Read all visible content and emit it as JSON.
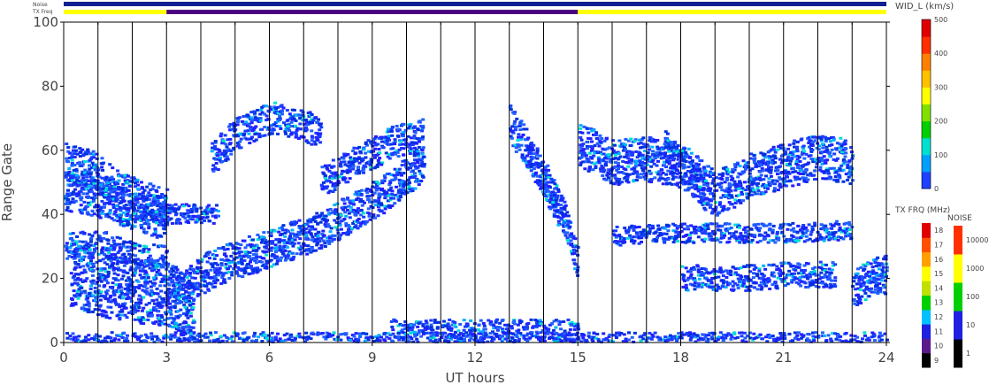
{
  "chart_data": {
    "type": "heatmap",
    "xlabel": "UT hours",
    "ylabel": "Range Gate",
    "xlim": [
      0,
      24
    ],
    "ylim": [
      0,
      100
    ],
    "x_ticks": [
      "0",
      "3",
      "6",
      "9",
      "12",
      "15",
      "18",
      "21",
      "24"
    ],
    "y_ticks": [
      "0",
      "20",
      "40",
      "60",
      "80",
      "100"
    ],
    "top_strips": {
      "noise_label": "Noise",
      "txfreq_label": "TX Freq",
      "txfreq_segments": [
        {
          "from": 0,
          "to": 3,
          "color": "#ffff00"
        },
        {
          "from": 3,
          "to": 15,
          "color": "#4b0082"
        },
        {
          "from": 15,
          "to": 24,
          "color": "#ffff00"
        }
      ]
    },
    "width_scale": {
      "label": "WID_L (km/s)",
      "ticks": [
        "0",
        "100",
        "200",
        "300",
        "400",
        "500"
      ],
      "colors": [
        "#2040ff",
        "#00a0ff",
        "#00e0d0",
        "#00d000",
        "#80e000",
        "#ffff00",
        "#ffc000",
        "#ff8000",
        "#ff3000",
        "#e00000"
      ]
    },
    "txfreq_scale": {
      "label": "TX FRQ (MHz)",
      "ticks": [
        "9",
        "10",
        "11",
        "12",
        "13",
        "14",
        "15",
        "16",
        "17",
        "18"
      ],
      "colors": [
        "#000000",
        "#5a1a8a",
        "#2020e0",
        "#00c0ff",
        "#00d000",
        "#c0e000",
        "#ffff00",
        "#ffa000",
        "#ff5000",
        "#e00000"
      ]
    },
    "noise_scale": {
      "label": "NOISE",
      "ticks": [
        "1",
        "10",
        "100",
        "1000",
        "10000"
      ],
      "colors": [
        "#000000",
        "#2020e0",
        "#00d000",
        "#ffff00",
        "#ff3000"
      ]
    },
    "echo_bands": [
      {
        "t": [
          0,
          1,
          2,
          3
        ],
        "g": [
          47,
          45,
          41,
          37
        ],
        "w": 6
      },
      {
        "t": [
          0,
          0.8,
          1.6,
          2.3,
          3
        ],
        "g": [
          56,
          54,
          47,
          44,
          42
        ],
        "w": 6
      },
      {
        "t": [
          0,
          1,
          2,
          3
        ],
        "g": [
          30,
          31,
          27,
          26
        ],
        "w": 4
      },
      {
        "t": [
          0.2,
          1,
          2,
          3,
          3.8
        ],
        "g": [
          21,
          18,
          16,
          15,
          10
        ],
        "w": 10
      },
      {
        "t": [
          3,
          4.5,
          6,
          7.5,
          9,
          10.5
        ],
        "g": [
          15,
          24,
          29,
          35,
          44,
          56
        ],
        "w": 6
      },
      {
        "t": [
          3,
          4,
          4.5
        ],
        "g": [
          40,
          40,
          40
        ],
        "w": 3
      },
      {
        "t": [
          4.3,
          5,
          6,
          7,
          7.5
        ],
        "g": [
          57,
          65,
          70,
          68,
          64
        ],
        "w": 5
      },
      {
        "t": [
          7.5,
          8.5,
          9.5,
          10.5
        ],
        "g": [
          50,
          56,
          62,
          65
        ],
        "w": 5
      },
      {
        "t": [
          13,
          13.8,
          14.5,
          15
        ],
        "g": [
          68,
          55,
          40,
          25
        ],
        "w": 6
      },
      {
        "t": [
          13.5,
          14,
          14.6
        ],
        "g": [
          58,
          50,
          40
        ],
        "w": 4
      },
      {
        "t": [
          15,
          16,
          17,
          18,
          19,
          20,
          21,
          22,
          23
        ],
        "g": [
          62,
          56,
          57,
          55,
          46,
          52,
          55,
          58,
          56
        ],
        "w": 7
      },
      {
        "t": [
          17.5,
          18.3,
          18.7
        ],
        "g": [
          62,
          52,
          45
        ],
        "w": 5
      },
      {
        "t": [
          16,
          18,
          20,
          21,
          23
        ],
        "g": [
          33,
          34,
          34,
          34,
          35
        ],
        "w": 3
      },
      {
        "t": [
          18,
          19,
          20,
          21,
          22.5
        ],
        "g": [
          20,
          20,
          20,
          21,
          21
        ],
        "w": 4
      },
      {
        "t": [
          23,
          23.5,
          24
        ],
        "g": [
          16,
          20,
          21
        ],
        "w": 6
      },
      {
        "t": [
          9.5,
          12,
          15
        ],
        "g": [
          3,
          3,
          3
        ],
        "w": 4
      },
      {
        "t": [
          0,
          3,
          6,
          9,
          12,
          15,
          18,
          21,
          24
        ],
        "g": [
          1,
          1,
          1,
          1,
          1,
          1,
          1,
          1,
          1
        ],
        "w": 2
      }
    ]
  }
}
